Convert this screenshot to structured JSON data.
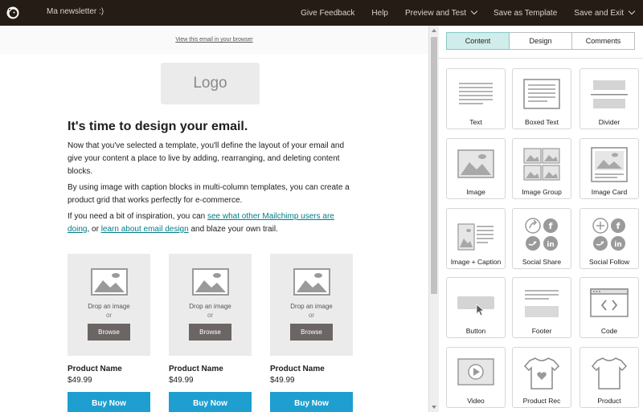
{
  "app": {
    "document_title": "Ma newsletter :)",
    "nav": [
      "Give Feedback",
      "Help",
      "Preview and Test",
      "Save as Template",
      "Save and Exit"
    ]
  },
  "email": {
    "view_in_browser": "View this email in your browser",
    "logo_placeholder": "Logo",
    "headline": "It's time to design your email.",
    "paragraph_1": "Now that you've selected a template, you'll define the layout of your email and give your content a place to live by adding, rearranging, and deleting content blocks.",
    "paragraph_2": "By using image with caption blocks in multi-column templates, you can create a product grid that works perfectly for e-commerce.",
    "paragraph_3": {
      "before": "If you need a bit of inspiration, you can ",
      "link_1": "see what other Mailchimp users are doing",
      "middle": ", or ",
      "link_2": "learn about email design",
      "after": " and blaze your own trail."
    },
    "products": [
      {
        "drop_text": "Drop an image",
        "or_text": "or",
        "browse_label": "Browse",
        "name": "Product Name",
        "price": "$49.99",
        "cta": "Buy Now"
      },
      {
        "drop_text": "Drop an image",
        "or_text": "or",
        "browse_label": "Browse",
        "name": "Product Name",
        "price": "$49.99",
        "cta": "Buy Now"
      },
      {
        "drop_text": "Drop an image",
        "or_text": "or",
        "browse_label": "Browse",
        "name": "Product Name",
        "price": "$49.99",
        "cta": "Buy Now"
      }
    ]
  },
  "panel": {
    "tabs": [
      "Content",
      "Design",
      "Comments"
    ],
    "active_tab": "Content",
    "blocks": [
      {
        "label": "Text",
        "icon": "text-block-icon"
      },
      {
        "label": "Boxed Text",
        "icon": "boxed-text-block-icon"
      },
      {
        "label": "Divider",
        "icon": "divider-block-icon"
      },
      {
        "label": "Image",
        "icon": "image-block-icon"
      },
      {
        "label": "Image Group",
        "icon": "image-group-block-icon"
      },
      {
        "label": "Image Card",
        "icon": "image-card-block-icon"
      },
      {
        "label": "Image + Caption",
        "icon": "image-caption-block-icon"
      },
      {
        "label": "Social Share",
        "icon": "social-share-block-icon"
      },
      {
        "label": "Social Follow",
        "icon": "social-follow-block-icon"
      },
      {
        "label": "Button",
        "icon": "button-block-icon"
      },
      {
        "label": "Footer",
        "icon": "footer-block-icon"
      },
      {
        "label": "Code",
        "icon": "code-block-icon"
      },
      {
        "label": "Video",
        "icon": "video-block-icon"
      },
      {
        "label": "Product Rec",
        "icon": "product-rec-block-icon"
      },
      {
        "label": "Product",
        "icon": "product-block-icon"
      }
    ]
  },
  "colors": {
    "topbar": "#241c15",
    "active_tab": "#d0eceb",
    "link": "#007c89",
    "buy_button": "#1e9fd0",
    "browse_button": "#6b6564",
    "placeholder": "#ebebeb"
  }
}
